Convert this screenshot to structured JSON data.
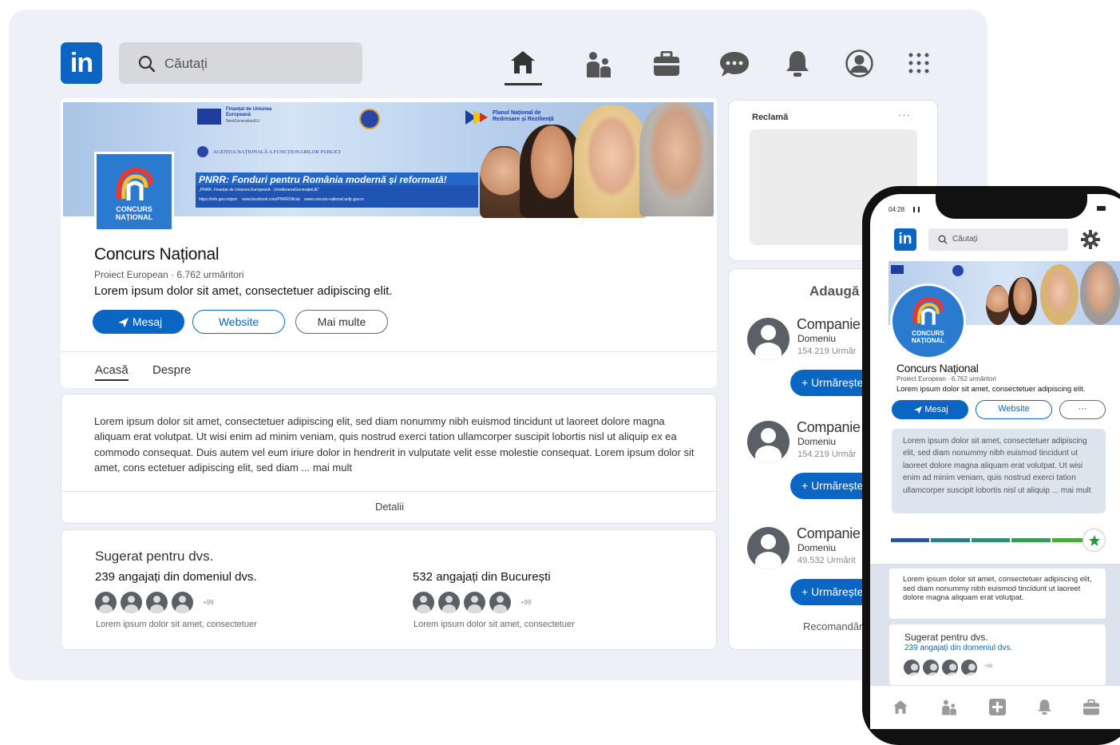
{
  "search": {
    "placeholder": "Căutați"
  },
  "page": {
    "name": "Concurs Național",
    "subtitle": "Proiect European · 6.762 urmăritori",
    "tagline": "Lorem ipsum dolor sit amet, consectetuer adipiscing elit.",
    "buttons": {
      "message": "Mesaj",
      "website": "Website",
      "more": "Mai multe"
    },
    "tabs": [
      "Acasă",
      "Despre"
    ],
    "logo_text": "CONCURS NAȚIONAL"
  },
  "banner": {
    "eu_text": "Finanțat de Uniunea Europeană",
    "eu_sub": "NextGenerationEU",
    "pnrr_right": "Planul Național de Redresare și Reziliență",
    "agency": "AGENȚIA NAȚIONALĂ A FUNCȚIONARILOR PUBLICI",
    "headline": "PNRR: Fonduri pentru România modernă și reformată!",
    "line1": "„PNRR. Finanțat de Uniunea Europeană - UrmătoareaGenerațieUE”",
    "links": "https://mfe.gov.ro/pnrr    www.facebook.com/PNRROficial    www.concurs-national.anfp.gov.ro"
  },
  "about": {
    "text": "Lorem ipsum dolor sit amet, consectetuer adipiscing elit, sed diam nonummy nibh euismod tincidunt ut laoreet dolore magna aliquam erat volutpat. Ut wisi enim ad minim veniam, quis nostrud exerci tation ullamcorper suscipit lobortis nisl ut aliquip ex ea commodo consequat. Duis autem vel eum iriure dolor in hendrerit in vulputate velit esse molestie consequat. Lorem ipsum dolor sit amet, cons ectetuer adipiscing elit, sed diam ... mai mult",
    "details": "Detalii"
  },
  "suggested": {
    "title": "Sugerat pentru dvs.",
    "left": {
      "label": "239 angajați din domeniul dvs.",
      "more": "+99",
      "caption": "Lorem ipsum dolor sit amet, consectetuer"
    },
    "right": {
      "label": "532 angajați din București",
      "more": "+99",
      "caption": "Lorem ipsum dolor sit amet, consectetuer"
    }
  },
  "ad": {
    "label": "Reclamă",
    "menu": "···"
  },
  "add_panel": {
    "title": "Adaugă",
    "companies": [
      {
        "name": "Companie",
        "domain": "Domeniu",
        "count": "154.219 Urmăr",
        "follow": "+ Urmărește"
      },
      {
        "name": "Companie",
        "domain": "Domeniu",
        "count": "154.219 Urmăr",
        "follow": "+ Urmărește"
      },
      {
        "name": "Companie",
        "domain": "Domeniu",
        "count": "49.532 Urmărit",
        "follow": "+ Urmărește"
      }
    ],
    "recommend": "Recomandări"
  },
  "phone": {
    "time": "04:28",
    "search_placeholder": "Căutați",
    "name": "Concurs Național",
    "subtitle": "Proiect European · 6.762 urmăritori",
    "tagline": "Lorem ipsum dolor sit amet, consectetuer adipiscing elit.",
    "btn_message": "Mesaj",
    "btn_website": "Website",
    "btn_more": "···",
    "about": "Lorem ipsum dolor sit amet, consectetuer adipiscing elit, sed diam nonummy nibh euismod tincidunt ut laoreet dolore magna aliquam erat volutpat. Ut wisi enim ad minim veniam, quis nostrud exerci tation ullamcorper suscipit lobortis nisl ut aliquip ... mai mult",
    "card_text": "Lorem ipsum dolor sit amet, consectetuer adipiscing elit, sed diam nonummy nibh euismod tincidunt ut laoreet dolore magna aliquam erat volutpat.",
    "suggested_title": "Sugerat pentru dvs.",
    "suggested_label": "239 angajați din domeniul dvs.",
    "suggested_more": "+99"
  },
  "colors": {
    "accent": "#0a66c2",
    "progress": [
      "#2f5597",
      "#2e7b8c",
      "#2f8f6f",
      "#3a9a4d",
      "#4aab3a"
    ]
  }
}
